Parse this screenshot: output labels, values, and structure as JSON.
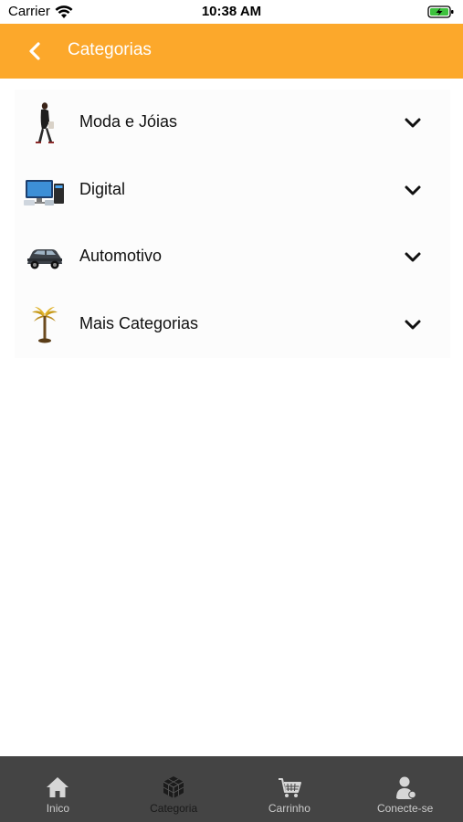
{
  "status_bar": {
    "carrier": "Carrier",
    "time": "10:38 AM"
  },
  "header": {
    "title": "Categorias",
    "back_icon": "chevron-left-icon",
    "background": "#fca82b"
  },
  "categories": [
    {
      "label": "Moda e Jóias",
      "thumb": "fashion-thumbnail",
      "expand_icon": "chevron-down-icon"
    },
    {
      "label": "Digital",
      "thumb": "electronics-thumbnail",
      "expand_icon": "chevron-down-icon"
    },
    {
      "label": "Automotivo",
      "thumb": "car-thumbnail",
      "expand_icon": "chevron-down-icon"
    },
    {
      "label": "Mais Categorias",
      "thumb": "palm-tree-thumbnail",
      "expand_icon": "chevron-down-icon"
    }
  ],
  "tab_bar": {
    "background": "#444444",
    "active_index": 1,
    "tabs": [
      {
        "label": "Inico",
        "icon": "home-icon"
      },
      {
        "label": "Categoria",
        "icon": "cube-icon"
      },
      {
        "label": "Carrinho",
        "icon": "cart-icon"
      },
      {
        "label": "Conecte-se",
        "icon": "user-icon"
      }
    ]
  }
}
